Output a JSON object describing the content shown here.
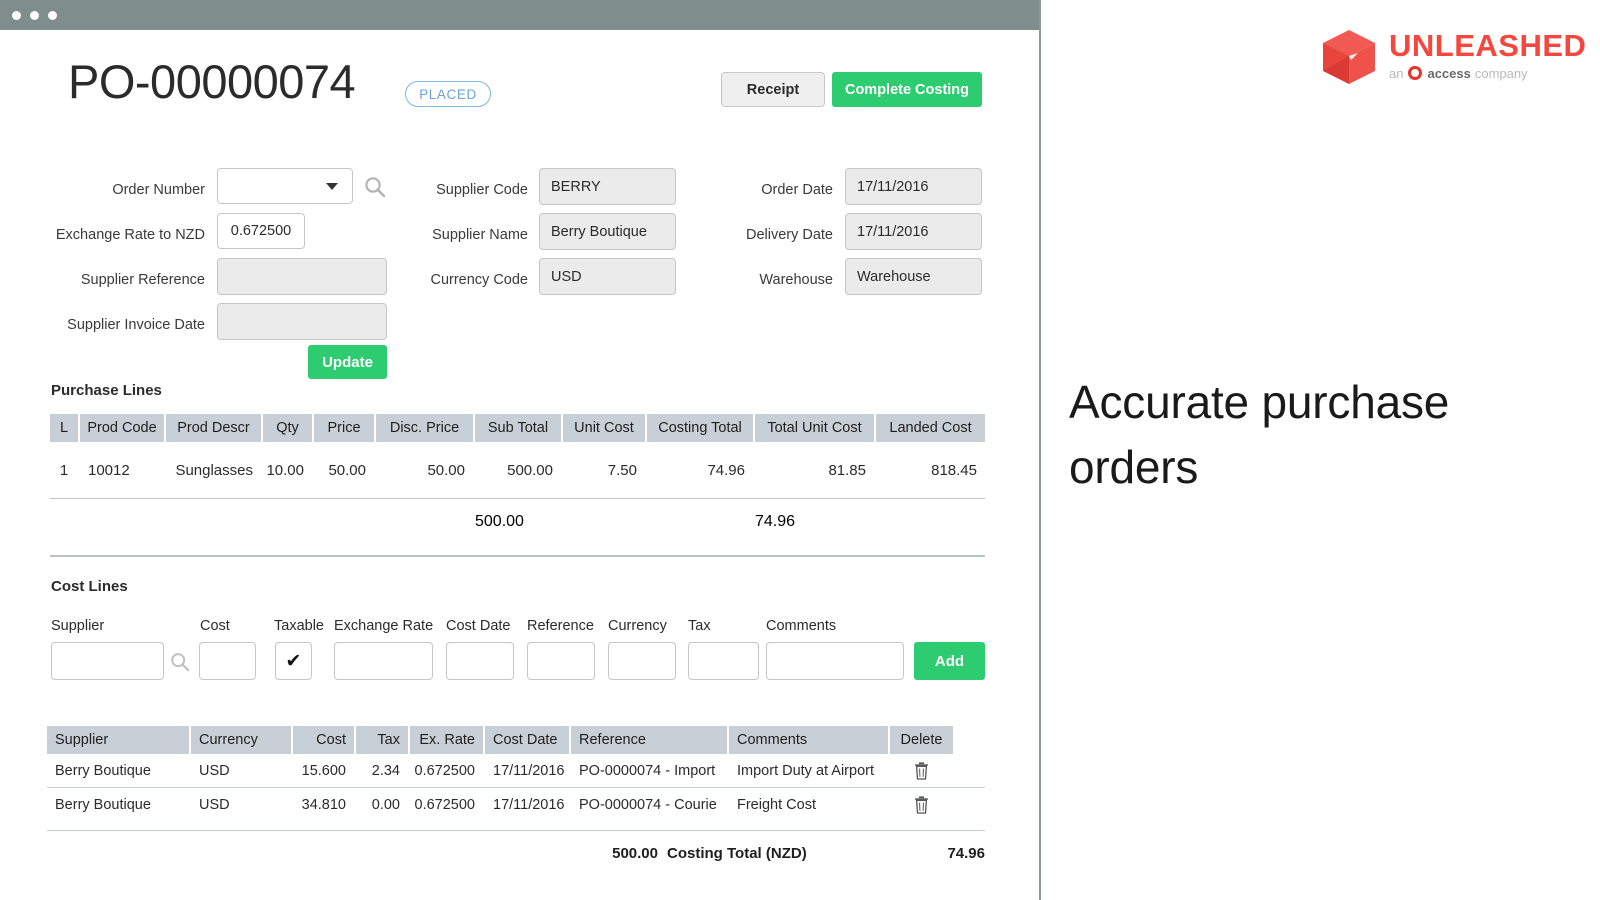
{
  "window": {
    "dots": [
      "close-dot",
      "minimize-dot",
      "maximize-dot"
    ]
  },
  "header": {
    "po_number": "PO-00000074",
    "status": "PLACED",
    "receipt_label": "Receipt",
    "complete_costing_label": "Complete Costing"
  },
  "form": {
    "col1": {
      "order_number_label": "Order Number",
      "order_number_value": "",
      "exchange_rate_label": "Exchange Rate to NZD",
      "exchange_rate_value": "0.672500",
      "update_label": "Update",
      "supplier_reference_label": "Supplier Reference",
      "supplier_reference_value": "",
      "supplier_invoice_date_label": "Supplier Invoice Date",
      "supplier_invoice_date_value": ""
    },
    "col2": {
      "supplier_code_label": "Supplier Code",
      "supplier_code_value": "BERRY",
      "supplier_name_label": "Supplier Name",
      "supplier_name_value": "Berry Boutique",
      "currency_code_label": "Currency Code",
      "currency_code_value": "USD"
    },
    "col3": {
      "order_date_label": "Order Date",
      "order_date_value": "17/11/2016",
      "delivery_date_label": "Delivery Date",
      "delivery_date_value": "17/11/2016",
      "warehouse_label": "Warehouse",
      "warehouse_value": "Warehouse"
    }
  },
  "purchase_lines": {
    "title": "Purchase Lines",
    "columns": [
      "L",
      "Prod Code",
      "Prod Descr",
      "Qty",
      "Price",
      "Disc. Price",
      "Sub Total",
      "Unit Cost",
      "Costing Total",
      "Total Unit Cost",
      "Landed Cost"
    ],
    "rows": [
      {
        "line": "1",
        "prod_code": "10012",
        "prod_descr": "Sunglasses",
        "qty": "10.00",
        "price": "50.00",
        "disc_price": "50.00",
        "sub_total": "500.00",
        "unit_cost": "7.50",
        "costing_total": "74.96",
        "total_unit_cost": "81.85",
        "landed_cost": "818.45"
      }
    ],
    "totals": {
      "sub_total": "500.00",
      "costing_total": "74.96"
    }
  },
  "cost_lines": {
    "title": "Cost Lines",
    "input_labels": {
      "supplier": "Supplier",
      "cost": "Cost",
      "taxable": "Taxable",
      "exchange_rate": "Exchange Rate",
      "cost_date": "Cost Date",
      "reference": "Reference",
      "currency": "Currency",
      "tax": "Tax",
      "comments": "Comments"
    },
    "input_values": {
      "supplier": "",
      "cost": "",
      "taxable_checked": "✔",
      "exchange_rate": "",
      "cost_date": "",
      "reference": "",
      "currency": "",
      "tax": "",
      "comments": ""
    },
    "add_label": "Add",
    "columns": [
      "Supplier",
      "Currency",
      "Cost",
      "Tax",
      "Ex. Rate",
      "Cost Date",
      "Reference",
      "Comments",
      "Delete"
    ],
    "rows": [
      {
        "supplier": "Berry Boutique",
        "currency": "USD",
        "cost": "15.600",
        "tax": "2.34",
        "ex_rate": "0.672500",
        "cost_date": "17/11/2016",
        "reference": "PO-0000074 - Import",
        "comments": "Import Duty at Airport",
        "delete_icon": "trash-icon"
      },
      {
        "supplier": "Berry Boutique",
        "currency": "USD",
        "cost": "34.810",
        "tax": "0.00",
        "ex_rate": "0.672500",
        "cost_date": "17/11/2016",
        "reference": "PO-0000074 - Courie",
        "comments": "Freight Cost",
        "delete_icon": "trash-icon"
      }
    ],
    "grand_total": {
      "amount": "500.00",
      "label": "Costing Total (NZD)",
      "value": "74.96"
    }
  },
  "brand": {
    "name": "UNLEASHED",
    "tagline_an": "an",
    "tagline_access": "access",
    "tagline_company": "company",
    "headline": "Accurate purchase orders",
    "accent_color": "#f4483f",
    "ring_color": "#e8332a"
  },
  "colors": {
    "titlebar": "#7f8e8d",
    "green": "#2ecc71",
    "table_header": "#c9cfd6",
    "badge_border": "#7fb6e3"
  }
}
